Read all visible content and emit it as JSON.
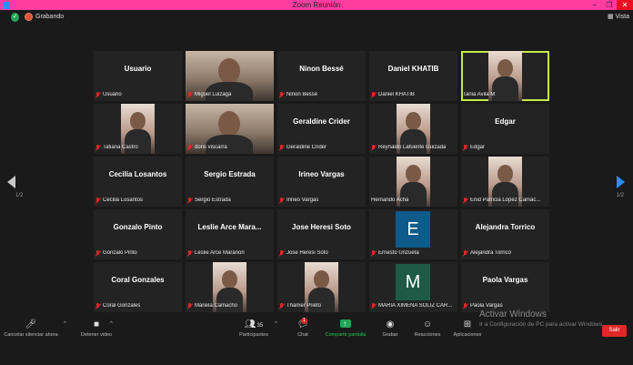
{
  "window": {
    "title": "Zoom Reunión",
    "controls": [
      "–",
      "❐",
      "✕"
    ]
  },
  "topbar": {
    "recording_label": "Grabando",
    "view_label": "Vista",
    "shield_icon": "✓"
  },
  "navigation": {
    "left_page": "1/2",
    "right_page": "1/2"
  },
  "tiles": [
    {
      "big_name": "Usuario",
      "label": "Usuario",
      "kind": "name",
      "muted": true
    },
    {
      "label": "Miguel Luizaga",
      "kind": "video-full",
      "muted": true
    },
    {
      "big_name": "Ninon Bessé",
      "label": "Ninon Bessé",
      "kind": "name",
      "muted": true
    },
    {
      "big_name": "Daniel KHATIB",
      "label": "Daniel KHATIB",
      "kind": "name",
      "muted": true
    },
    {
      "label": "Tania Avila M",
      "kind": "video-portrait",
      "muted": false,
      "active": true
    },
    {
      "label": "Tatiana Castro",
      "kind": "video-portrait",
      "muted": true
    },
    {
      "label": "doris viscarra",
      "kind": "video-full",
      "muted": true
    },
    {
      "big_name": "Geraldine Crider",
      "label": "Geraldine Crider",
      "kind": "name",
      "muted": true
    },
    {
      "label": "Reynaldo Lafuente Guizada",
      "kind": "video-portrait",
      "muted": true
    },
    {
      "big_name": "Edgar",
      "label": "Edgar",
      "kind": "name",
      "muted": true
    },
    {
      "big_name": "Cecilia Losantos",
      "label": "Cecilia Losantos",
      "kind": "name",
      "muted": true
    },
    {
      "big_name": "Sergio Estrada",
      "label": "Sergio Estrada",
      "kind": "name",
      "muted": true
    },
    {
      "big_name": "Irineo Vargas",
      "label": "Irineo Vargas",
      "kind": "name",
      "muted": true
    },
    {
      "label": "Hernando Achá",
      "kind": "video-portrait",
      "muted": false
    },
    {
      "label": "Enid Patricia López Camac...",
      "kind": "video-portrait",
      "muted": true
    },
    {
      "big_name": "Gonzalo Pinto",
      "label": "Gonzalo Pinto",
      "kind": "name",
      "muted": true
    },
    {
      "big_name": "Leslie Arce Mara...",
      "label": "Leslie Arce Marañón",
      "kind": "name",
      "muted": true
    },
    {
      "big_name": "Jose Heresi Soto",
      "label": "Jose Heresi Soto",
      "kind": "name",
      "muted": true
    },
    {
      "label": "Ernesto Unzueta",
      "kind": "letter",
      "letter": "E",
      "color": "#0e5a8a",
      "muted": true
    },
    {
      "big_name": "Alejandra Torrico",
      "label": "Alejandra Torrico",
      "kind": "name",
      "muted": true
    },
    {
      "big_name": "Coral Gonzales",
      "label": "Coral Gonzales",
      "kind": "name",
      "muted": true
    },
    {
      "label": "Mariela Camacho",
      "kind": "video-portrait",
      "muted": true
    },
    {
      "label": "Thamer Prieto",
      "kind": "video-portrait",
      "muted": true
    },
    {
      "label": "MARIA XIMENA SOLIZ CAR...",
      "kind": "letter",
      "letter": "M",
      "color": "#1e5a46",
      "muted": true
    },
    {
      "big_name": "Paola Vargas",
      "label": "Paola Vargas",
      "kind": "name",
      "muted": true
    }
  ],
  "toolbar": {
    "audio_label": "Cancelar silenciar ahora",
    "video_label": "Detener video",
    "participants_label": "Participantes",
    "participants_count": "35",
    "chat_label": "Chat",
    "chat_badge": "1",
    "share_label": "Compartir pantalla",
    "record_label": "Grabar",
    "reactions_label": "Reacciones",
    "apps_label": "Aplicaciones",
    "leave_label": "Salir",
    "caret": "^"
  },
  "watermark": {
    "title": "Activar Windows",
    "subtitle": "Ir a Configuración de PC para activar Windows."
  },
  "colors": {
    "titlebar": "#ff3ca0",
    "active_speaker": "#c8e84a",
    "share_green": "#23a55a",
    "leave_red": "#e02828",
    "nav_right": "#2d8cff"
  }
}
